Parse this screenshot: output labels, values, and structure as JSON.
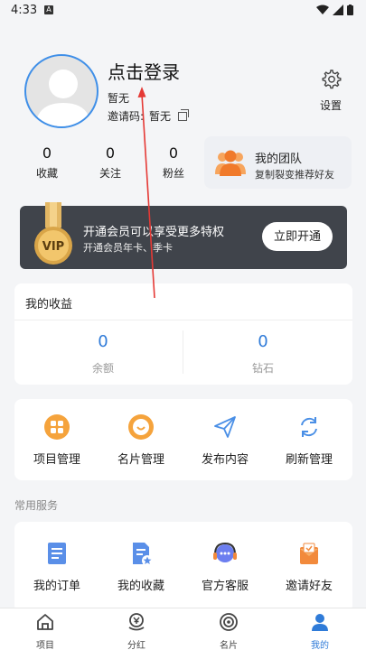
{
  "status_bar": {
    "time": "4:33",
    "notif_glyph": "A"
  },
  "profile": {
    "login_prompt": "点击登录",
    "nickname": "暂无",
    "invite_label": "邀请码:",
    "invite_value": "暂无",
    "settings_label": "设置"
  },
  "stats": [
    {
      "value": "0",
      "label": "收藏"
    },
    {
      "value": "0",
      "label": "关注"
    },
    {
      "value": "0",
      "label": "粉丝"
    }
  ],
  "team": {
    "title": "我的团队",
    "subtitle": "复制裂变推荐好友"
  },
  "vip": {
    "title": "开通会员可以享受更多特权",
    "subtitle": "开通会员年卡、季卡",
    "badge_text": "VIP",
    "button_label": "立即开通"
  },
  "earnings": {
    "title": "我的收益",
    "items": [
      {
        "value": "0",
        "label": "余额"
      },
      {
        "value": "0",
        "label": "钻石"
      }
    ]
  },
  "tools": [
    {
      "label": "项目管理",
      "icon": "grid-icon"
    },
    {
      "label": "名片管理",
      "icon": "card-icon"
    },
    {
      "label": "发布内容",
      "icon": "send-icon"
    },
    {
      "label": "刷新管理",
      "icon": "refresh-icon"
    }
  ],
  "services": {
    "title": "常用服务",
    "items": [
      {
        "label": "我的订单",
        "icon": "order-icon"
      },
      {
        "label": "我的收藏",
        "icon": "favorite-doc-icon"
      },
      {
        "label": "官方客服",
        "icon": "headset-icon"
      },
      {
        "label": "邀请好友",
        "icon": "invite-icon"
      }
    ]
  },
  "tabbar": [
    {
      "label": "项目",
      "icon": "home-icon",
      "active": false
    },
    {
      "label": "分红",
      "icon": "dividend-icon",
      "active": false
    },
    {
      "label": "名片",
      "icon": "target-icon",
      "active": false
    },
    {
      "label": "我的",
      "icon": "user-icon",
      "active": true
    }
  ],
  "colors": {
    "accent": "#2f7bd8",
    "vip_bg": "#40444b",
    "background": "#f4f5f7",
    "orange": "#f28a3c"
  }
}
